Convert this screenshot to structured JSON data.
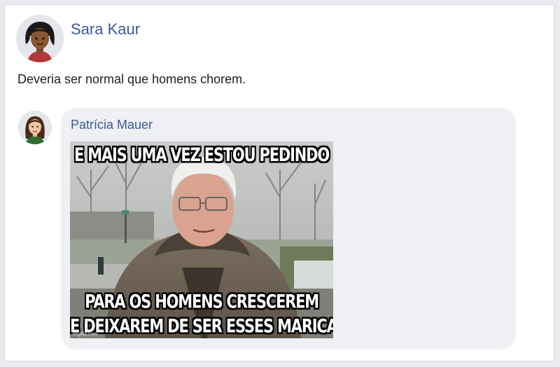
{
  "post": {
    "author": "Sara Kaur",
    "text": "Deveria ser normal que homens chorem."
  },
  "comment": {
    "author": "Patrícia Mauer",
    "meme": {
      "top_text": "E MAIS UMA VEZ ESTOU PEDINDO",
      "bottom_line_1": "PARA OS HOMENS CRESCEREM",
      "bottom_line_2": "E DEIXAREM DE SER ESSES MARICAS",
      "watermark": "imgflip.com"
    }
  },
  "colors": {
    "link": "#3b5998",
    "bubble": "#eff0f3",
    "page_bg": "#e9ebee"
  },
  "icons": [
    "post-author-avatar-icon",
    "comment-author-avatar-icon"
  ]
}
